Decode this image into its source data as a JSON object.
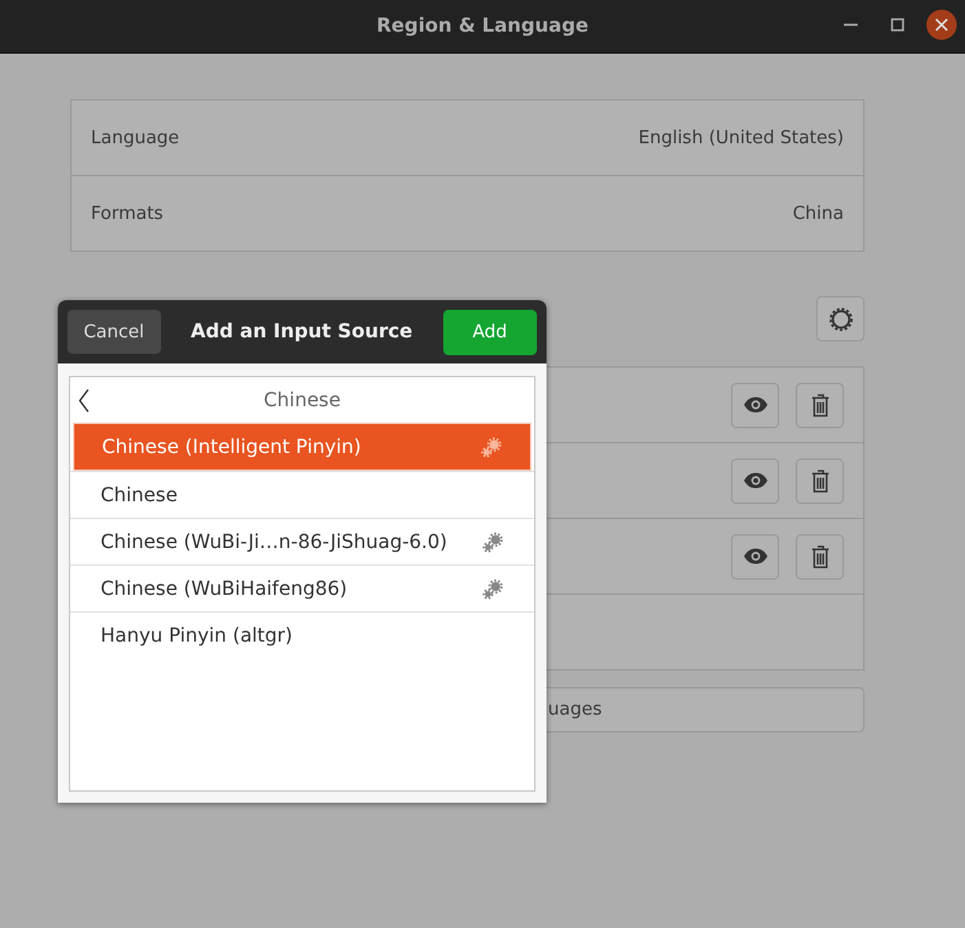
{
  "window": {
    "title": "Region & Language"
  },
  "settings": [
    {
      "label": "Language",
      "value": "English (United States)"
    },
    {
      "label": "Formats",
      "value": "China"
    }
  ],
  "input_sources": {
    "rows": [
      {
        "kind": "source"
      },
      {
        "kind": "source"
      },
      {
        "kind": "source"
      },
      {
        "kind": "empty"
      }
    ]
  },
  "manage_button": {
    "label": "uages"
  },
  "dialog": {
    "title": "Add an Input Source",
    "cancel": "Cancel",
    "add": "Add",
    "group": "Chinese",
    "items": [
      {
        "label": "Chinese (Intelligent Pinyin)",
        "selected": true,
        "configurable": true
      },
      {
        "label": "Chinese",
        "selected": false,
        "configurable": false
      },
      {
        "label": "Chinese (WuBi-Ji…n-86-JiShuag-6.0)",
        "selected": false,
        "configurable": true
      },
      {
        "label": "Chinese (WuBiHaifeng86)",
        "selected": false,
        "configurable": true
      },
      {
        "label": "Hanyu Pinyin (altgr)",
        "selected": false,
        "configurable": false
      }
    ]
  }
}
